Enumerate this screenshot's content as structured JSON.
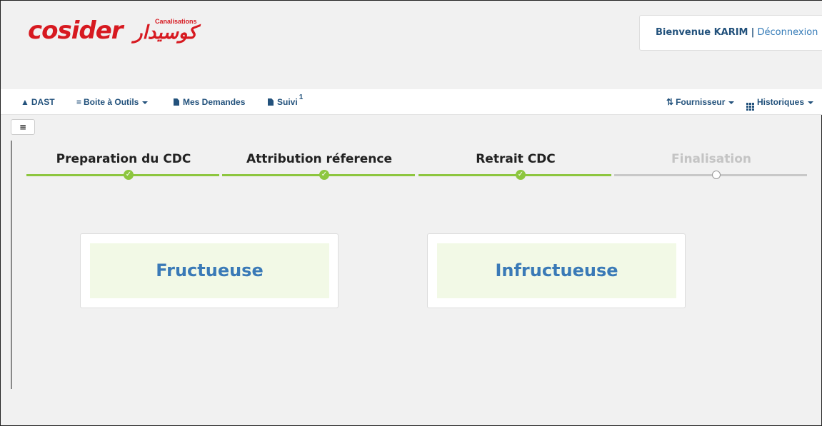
{
  "brand": {
    "logo_latin": "cosider",
    "logo_arabic": "كوسيدار",
    "logo_tag": "Canalisations"
  },
  "user": {
    "welcome": "Bienvenue KARIM",
    "separator": "|",
    "logout": "Déconnexion"
  },
  "nav": {
    "home": "DAST",
    "tools": "Boite à Outils",
    "requests": "Mes Demandes",
    "tracking": "Suivi",
    "tracking_badge": "1",
    "supplier": "Fournisseur",
    "history": "Historiques"
  },
  "steps": [
    {
      "label": "Preparation du CDC",
      "status": "done"
    },
    {
      "label": "Attribution réference",
      "status": "done"
    },
    {
      "label": "Retrait CDC",
      "status": "done"
    },
    {
      "label": "Finalisation",
      "status": "pending"
    }
  ],
  "choices": {
    "success": "Fructueuse",
    "failure": "Infructueuse"
  },
  "colors": {
    "brand_red": "#d71920",
    "nav_blue": "#23527c",
    "step_green": "#8dc63f",
    "choice_text": "#3a7ab7",
    "choice_bg": "#f2f9e6"
  }
}
